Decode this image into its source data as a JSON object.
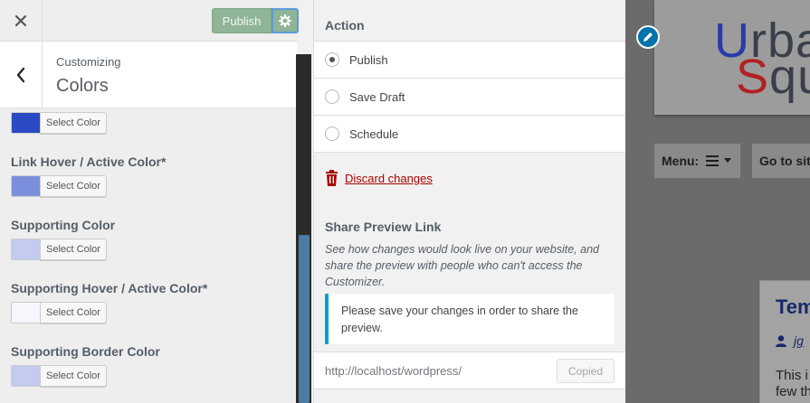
{
  "header": {
    "close_icon": "close-icon",
    "publish_label": "Publish",
    "gear_icon": "gear-icon"
  },
  "section": {
    "breadcrumb": "Customizing",
    "title": "Colors"
  },
  "controls": [
    {
      "label": "",
      "color": "#2a4ac4",
      "button": "Select Color"
    },
    {
      "label": "Link Hover / Active Color*",
      "color": "#7b8fdc",
      "button": "Select Color"
    },
    {
      "label": "Supporting Color",
      "color": "#c3cbf0",
      "button": "Select Color"
    },
    {
      "label": "Supporting Hover / Active Color*",
      "color": "#f6f7fc",
      "button": "Select Color"
    },
    {
      "label": "Supporting Border Color",
      "color": "#c3cbf0",
      "button": "Select Color"
    }
  ],
  "publish_settings": {
    "action_title": "Action",
    "options": [
      {
        "label": "Publish",
        "selected": true
      },
      {
        "label": "Save Draft",
        "selected": false
      },
      {
        "label": "Schedule",
        "selected": false
      }
    ],
    "discard_label": "Discard changes",
    "share_title": "Share Preview Link",
    "share_desc": "See how changes would look live on your website, and share the preview with people who can't access the Customizer.",
    "notice": "Please save your changes in order to share the preview.",
    "url": "http://localhost/wordpress/",
    "copied_label": "Copied"
  },
  "preview": {
    "logo_line1_first": "U",
    "logo_line1_rest": "rban",
    "logo_line2_first": "S",
    "logo_line2_rest": "qua",
    "menu_label": "Menu:",
    "goto_label": "Go to sit",
    "post_title": "Tem",
    "post_author": "jg",
    "post_text1": "This i",
    "post_text2": "few th"
  },
  "colors": {
    "accent_blue": "#0073aa",
    "publish_green": "#8fb496",
    "discard_red": "#aa0000",
    "logo_blue": "#2a3aa8",
    "logo_red": "#b22222"
  }
}
